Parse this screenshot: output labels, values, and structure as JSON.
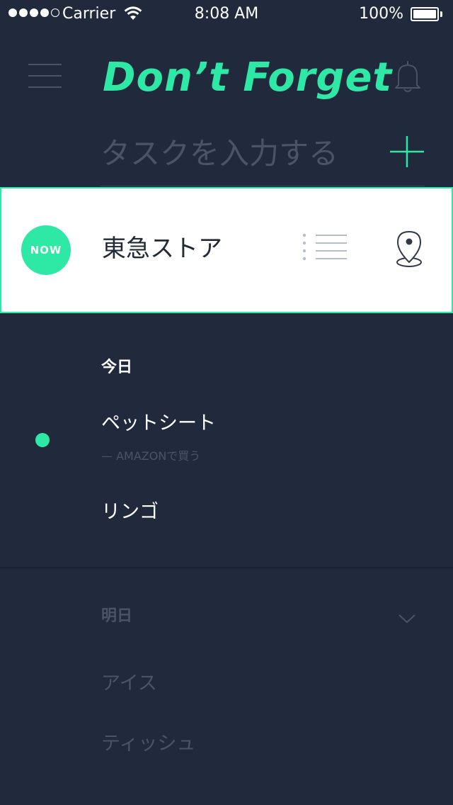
{
  "status_bar": {
    "carrier": "Carrier",
    "time": "8:08 AM",
    "battery_percent": "100%",
    "signal_bars_filled": 4,
    "signal_bars_total": 5,
    "battery_level": 1.0
  },
  "header": {
    "title": "Don’t Forget",
    "menu_icon": "hamburger-menu-icon",
    "bell_icon": "bell-icon"
  },
  "task_input": {
    "placeholder": "タスクを入力する",
    "value": "",
    "add_icon": "plus-icon"
  },
  "now_card": {
    "badge": "NOW",
    "store": "東急ストア",
    "list_icon": "list-icon",
    "location_icon": "map-pin-icon"
  },
  "today": {
    "header": "今日",
    "items": [
      {
        "title": "ペットシート",
        "subtitle": "— AMAZONで買う",
        "active": true
      },
      {
        "title": "リンゴ",
        "subtitle": "",
        "active": false
      }
    ]
  },
  "tomorrow": {
    "header": "明日",
    "collapsed_icon": "chevron-down-icon",
    "items": [
      {
        "title": "アイス"
      },
      {
        "title": "ティッシュ"
      }
    ]
  },
  "colors": {
    "background": "#212a3c",
    "accent": "#2ee8a5",
    "muted": "#4b5467",
    "card_background": "#ffffff",
    "card_text": "#222a38"
  }
}
